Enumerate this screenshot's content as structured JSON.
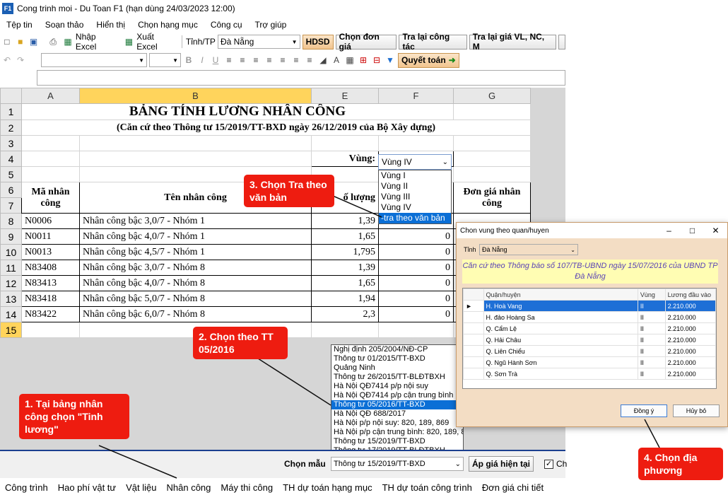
{
  "window": {
    "title": "Cong trinh moi - Du Toan F1  (hạn dùng 24/03/2023 12:00)",
    "logo": "F1"
  },
  "menu": [
    "Tệp tin",
    "Soạn thảo",
    "Hiển thị",
    "Chọn hạng mục",
    "Công cụ",
    "Trợ giúp"
  ],
  "toolbar": {
    "import_excel": "Nhập Excel",
    "export_excel": "Xuất Excel",
    "province_label": "Tỉnh/TP",
    "province_value": "Đà Nẵng",
    "hdsd": "HDSD",
    "chon_don_gia": "Chọn đơn giá",
    "tra_cong_tac": "Tra lại công tác",
    "tra_gia": "Tra lại giá VL, NC, M",
    "quyet_toan": "Quyết toán",
    "font_b": "B",
    "font_i": "I",
    "font_u": "U"
  },
  "sheet": {
    "col_headers": [
      "A",
      "B",
      "E",
      "F",
      "G"
    ],
    "row_numbers": [
      "1",
      "2",
      "3",
      "4",
      "5",
      "6",
      "7",
      "8",
      "9",
      "10",
      "11",
      "12",
      "13",
      "14",
      "15"
    ],
    "title": "BẢNG TÍNH LƯƠNG NHÂN CÔNG",
    "subtitle": "(Căn cứ theo Thông tư 15/2019/TT-BXD ngày 26/12/2019 của Bộ Xây dựng)",
    "vung_label": "Vùng:",
    "vung_value": "Vùng IV",
    "hdr_ma": "Mã nhân công",
    "hdr_ten": "Tên nhân công",
    "hdr_luong": "ố lượng",
    "hdr_dongia": "Đơn giá nhân công",
    "rows": [
      {
        "ma": "N0006",
        "ten": "Nhân công bậc 3,0/7 - Nhóm 1",
        "he_so": "1,39",
        "gia": ""
      },
      {
        "ma": "N0011",
        "ten": "Nhân công bậc 4,0/7 - Nhóm 1",
        "he_so": "1,65",
        "gia": "0"
      },
      {
        "ma": "N0013",
        "ten": "Nhân công bậc 4,5/7 - Nhóm 1",
        "he_so": "1,795",
        "gia": "0"
      },
      {
        "ma": "N83408",
        "ten": "Nhân công bậc 3,0/7 - Nhóm 8",
        "he_so": "1,39",
        "gia": "0"
      },
      {
        "ma": "N83413",
        "ten": "Nhân công bậc 4,0/7 - Nhóm 8",
        "he_so": "1,65",
        "gia": "0"
      },
      {
        "ma": "N83418",
        "ten": "Nhân công bậc 5,0/7 - Nhóm 8",
        "he_so": "1,94",
        "gia": "0"
      },
      {
        "ma": "N83422",
        "ten": "Nhân công bậc 6,0/7 - Nhóm 8",
        "he_so": "2,3",
        "gia": "0"
      }
    ]
  },
  "vung_options": [
    "Vùng I",
    "Vùng II",
    "Vùng III",
    "Vùng IV",
    "-tra theo văn bản"
  ],
  "template_options": [
    "Nghị định 205/2004/NĐ-CP",
    "Thông tư 01/2015/TT-BXD",
    "Quảng Ninh",
    "Thông tư 26/2015/TT-BLĐTBXH",
    "Hà Nội QĐ7414 p/p nội suy",
    "Hà Nội QĐ7414 p/p cận trung bình",
    "Thông tư 05/2016/TT-BXD",
    "Hà Nội QĐ 688/2017",
    "Hà Nội p/p nội suy: 820, 189, 869",
    "Hà Nội p/p cận trung bình: 820, 189, 8",
    "Thông tư 15/2019/TT-BXD",
    "Thông tư 17/2019/TT-BLĐTBXH"
  ],
  "bottom": {
    "chon_mau_label": "Chọn mẫu",
    "chon_mau_value": "Thông tư 15/2019/TT-BXD",
    "ap_gia": "Áp giá hiện tại",
    "checkbox_label": "Ch"
  },
  "tabs": [
    "Công trình",
    "Hao phí vật tư",
    "Vật liệu",
    "Nhân công",
    "Máy thi công",
    "TH dự toán hạng mục",
    "TH dự toán công trình",
    "Đơn giá chi tiết"
  ],
  "callouts": {
    "c1": "1. Tại bảng nhân công chọn \"Tinh lương\"",
    "c2": "2. Chọn theo TT 05/2016",
    "c3": "3. Chọn Tra theo văn bản",
    "c4": "4. Chọn địa phương"
  },
  "dialog": {
    "title": "Chon vung theo quan/huyen",
    "tinh_label": "Tỉnh",
    "tinh_value": "Đà Nẵng",
    "note": "Căn cứ theo Thông báo số 107/TB-UBND ngày 15/07/2016 của UBND TP Đà Nẵng",
    "headers": [
      "Quận/huyện",
      "Vùng",
      "Lương đầu vào"
    ],
    "rows": [
      {
        "qh": "H. Hoà Vang",
        "vung": "II",
        "luong": "2.210.000"
      },
      {
        "qh": "H. đảo Hoàng Sa",
        "vung": "II",
        "luong": "2.210.000"
      },
      {
        "qh": "Q. Cẩm Lệ",
        "vung": "II",
        "luong": "2.210.000"
      },
      {
        "qh": "Q. Hải Châu",
        "vung": "II",
        "luong": "2.210.000"
      },
      {
        "qh": "Q. Liên Chiểu",
        "vung": "II",
        "luong": "2.210.000"
      },
      {
        "qh": "Q. Ngũ Hành Sơn",
        "vung": "II",
        "luong": "2.210.000"
      },
      {
        "qh": "Q. Sơn Trà",
        "vung": "II",
        "luong": "2.210.000"
      }
    ],
    "ok": "Đồng ý",
    "cancel": "Hủy bỏ"
  }
}
